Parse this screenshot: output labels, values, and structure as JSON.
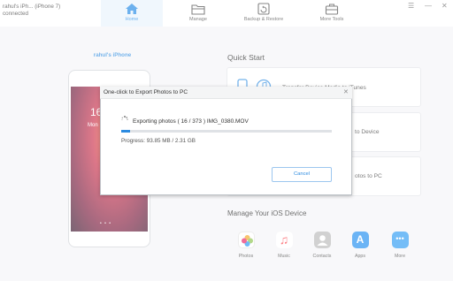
{
  "device": {
    "name": "rahul's iPh... (iPhone 7)",
    "status": "connected",
    "phone_title": "rahul's iPhone"
  },
  "nav": {
    "tabs": [
      {
        "label": "Home",
        "icon": "home-icon"
      },
      {
        "label": "Manage",
        "icon": "folder-icon"
      },
      {
        "label": "Backup & Restore",
        "icon": "backup-icon"
      },
      {
        "label": "More Tools",
        "icon": "toolbox-icon"
      }
    ]
  },
  "phone": {
    "time": "16",
    "date": "Mon"
  },
  "quick_start": {
    "title": "Quick Start",
    "items": [
      {
        "label": "Transfer Device Media to iTunes"
      },
      {
        "label": "to Device"
      },
      {
        "label": "otos to PC"
      }
    ]
  },
  "manage": {
    "title": "Manage Your iOS Device",
    "apps": [
      {
        "label": "Photos",
        "icon": "photos-icon",
        "color": "#f5a623"
      },
      {
        "label": "Music",
        "icon": "music-icon",
        "color": "#fc3c44"
      },
      {
        "label": "Contacts",
        "icon": "contacts-icon",
        "color": "#9a9a9a"
      },
      {
        "label": "Apps",
        "icon": "appstore-icon",
        "color": "#1d8cf0"
      },
      {
        "label": "More",
        "icon": "more-icon",
        "color": "#2a9af3"
      }
    ]
  },
  "dialog": {
    "title": "One-click to Export Photos to PC",
    "status": "Exporting photos ( 16 / 373 )  IMG_0380.MOV",
    "progress_fraction": 0.043,
    "progress_text": "Progress: 93.85 MB  /  2.31 GB",
    "cancel_label": "Cancel"
  }
}
